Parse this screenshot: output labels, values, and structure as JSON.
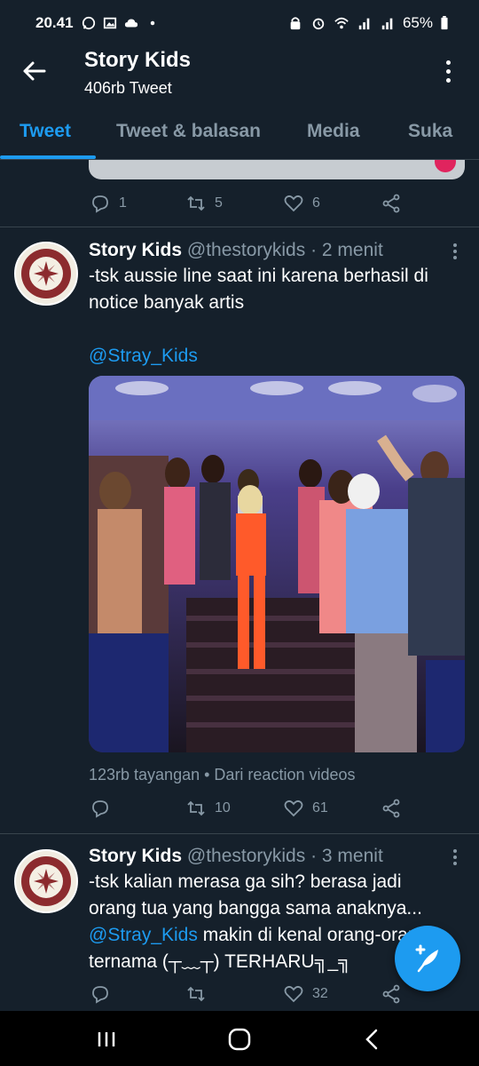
{
  "status_bar": {
    "time": "20.41",
    "battery": "65%",
    "icons": [
      "whatsapp-icon",
      "gallery-icon",
      "cloud-icon",
      "dot-icon",
      "lock-icon",
      "alarm-icon",
      "wifi-icon",
      "signal-icon",
      "signal-icon",
      "battery-icon"
    ]
  },
  "header": {
    "title": "Story Kids",
    "subtitle": "406rb Tweet"
  },
  "tabs": [
    {
      "label": "Tweet",
      "active": true
    },
    {
      "label": "Tweet & balasan",
      "active": false
    },
    {
      "label": "Media",
      "active": false
    },
    {
      "label": "Suka",
      "active": false
    }
  ],
  "previous_tweet": {
    "replies": "1",
    "retweets": "5",
    "likes": "6"
  },
  "tweets": [
    {
      "name": "Story Kids",
      "handle": "@thestorykids",
      "time": "· 2 menit",
      "text_line1": "-tsk aussie line saat ini karena berhasil di",
      "text_line2": "notice banyak artis",
      "mention": "@Stray_Kids",
      "views": "123rb tayangan",
      "source": "• Dari reaction videos",
      "replies": "",
      "retweets": "10",
      "likes": "61"
    },
    {
      "name": "Story Kids",
      "handle": "@thestorykids",
      "time": "· 3 menit",
      "text_line1": "-tsk kalian merasa ga sih? berasa jadi",
      "text_line2": "orang tua yang bangga sama anaknya...",
      "mention": "@Stray_Kids",
      "text_after_mention": " makin di kenal orang-orang",
      "text_line4": "ternama  (┬﹏┬) TERHARU╗_╗",
      "replies": "",
      "retweets": "",
      "likes": "32"
    }
  ],
  "colors": {
    "background": "#15202b",
    "accent": "#1d9bf0",
    "muted": "#8899a6",
    "divider": "#38444d"
  }
}
